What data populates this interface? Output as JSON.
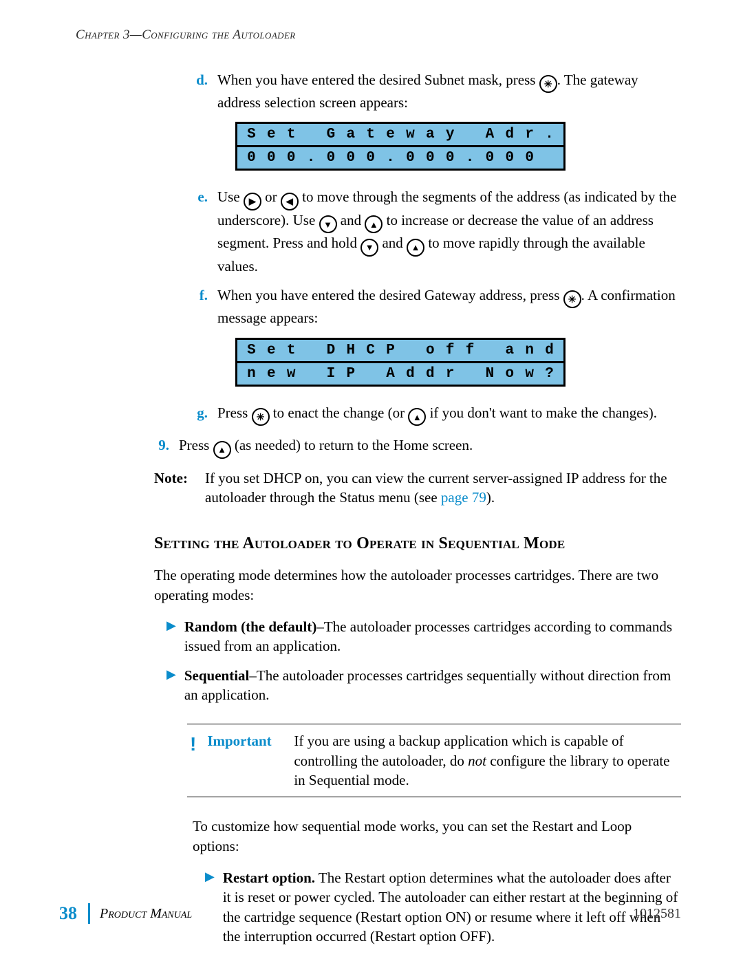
{
  "header": {
    "chapter": "Chapter 3—Configuring the Autoloader"
  },
  "steps": {
    "d": {
      "label": "d.",
      "part1": "When you have entered the desired Subnet mask, press ",
      "part2": ". The gateway address selection screen appears:"
    },
    "e": {
      "label": "e.",
      "part1": "Use ",
      "part2": " or ",
      "part3": " to move through the segments of the address (as indicated by the underscore). Use ",
      "part4": " and ",
      "part5": " to increase or decrease the value of an address segment. Press and hold ",
      "part6": " and ",
      "part7": " to move rapidly through the available values."
    },
    "f": {
      "label": "f.",
      "part1": "When you have entered the desired Gateway address, press ",
      "part2": ". A confirmation message appears:"
    },
    "g": {
      "label": "g.",
      "part1": "Press ",
      "part2": " to enact the change (or ",
      "part3": " if you don't want to make the changes)."
    },
    "nine": {
      "label": "9.",
      "part1": "Press ",
      "part2": " (as needed) to return to the Home screen."
    }
  },
  "lcd1": {
    "row1": [
      "S",
      "e",
      "t",
      "",
      "G",
      "a",
      "t",
      "e",
      "w",
      "a",
      "y",
      "",
      "A",
      "d",
      "r",
      "."
    ],
    "row2": [
      "0",
      "0",
      "0",
      ".",
      "0",
      "0",
      "0",
      ".",
      "0",
      "0",
      "0",
      ".",
      "0",
      "0",
      "0",
      ""
    ]
  },
  "lcd2": {
    "row1": [
      "S",
      "e",
      "t",
      "",
      "D",
      "H",
      "C",
      "P",
      "",
      "o",
      "f",
      "f",
      "",
      "a",
      "n",
      "d"
    ],
    "row2": [
      "n",
      "e",
      "w",
      "",
      "I",
      "P",
      "",
      "A",
      "d",
      "d",
      "r",
      "",
      "N",
      "o",
      "w",
      "?"
    ]
  },
  "note": {
    "label": "Note:",
    "text_pre": "If you set DHCP on, you can view the current server-assigned IP address for the autoloader through the Status menu (see ",
    "link": "page 79",
    "text_post": ")."
  },
  "section": {
    "title": "Setting the Autoloader to Operate in Sequential Mode",
    "intro": "The operating mode determines how the autoloader processes cartridges. There are two operating modes:",
    "bullet1_bold": "Random (the default)",
    "bullet1_rest": "–The autoloader processes cartridges according to commands issued from an application.",
    "bullet2_bold": "Sequential",
    "bullet2_rest": "–The autoloader processes cartridges sequentially without direction from an application.",
    "important": {
      "label": "Important",
      "text_pre": "If you are using a backup application which is capable of controlling the autoloader, do ",
      "text_ital": "not",
      "text_post": " configure the library to operate in Sequential mode."
    },
    "after_important": "To customize how sequential mode works, you can set the Restart and Loop options:",
    "restart_bold": "Restart option.",
    "restart_text": " The Restart option determines what the autoloader does after it is reset or power cycled. The autoloader can either restart at the beginning of the cartridge sequence (Restart option ON) or resume where it left off when the interruption occurred (Restart option OFF)."
  },
  "footer": {
    "page": "38",
    "manual": "Product Manual",
    "docnum": "1012581"
  }
}
